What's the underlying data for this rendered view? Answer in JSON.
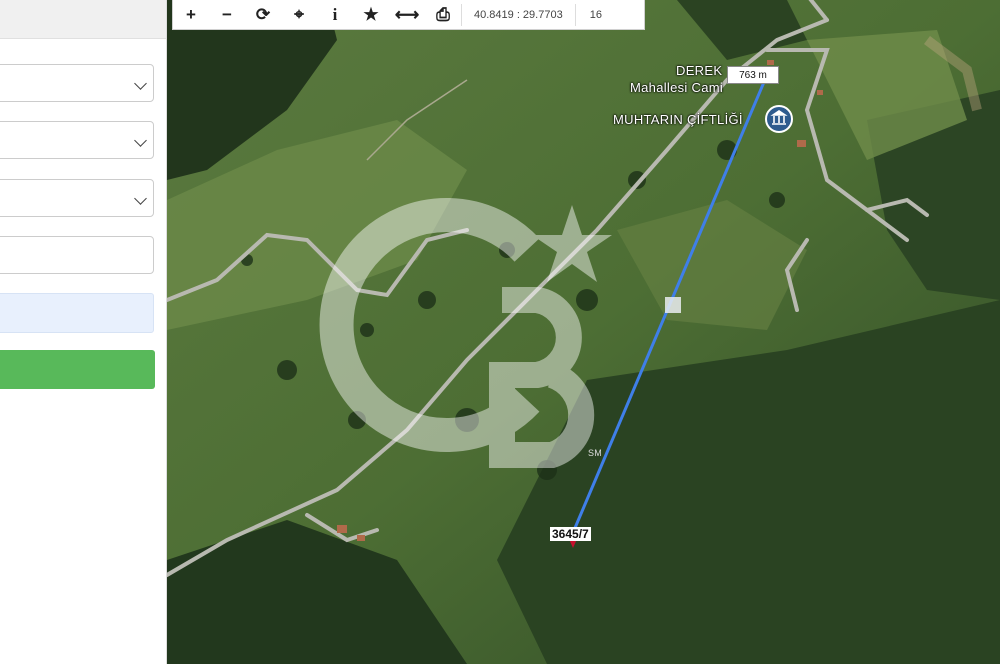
{
  "toolbar": {
    "zoom_in": "+",
    "zoom_out": "−",
    "refresh": "⟳",
    "locate": "⌖",
    "info": "i",
    "favorite": "★",
    "measure": "⟷",
    "print": "⎙",
    "coordinates": "40.8419 : 29.7703",
    "zoom_level": "16"
  },
  "map": {
    "labels": {
      "mosque_line1": "DEREK",
      "mosque_line2": "Mahallesi Cami",
      "farm": "MUHTARIN ÇİFTLİĞİ"
    },
    "distance": "763 m",
    "parcel": "3645/7",
    "watermark_sm": "SM",
    "colors": {
      "measure_line": "#3f7fe8",
      "marker": "#c8102e"
    },
    "icons": {
      "museum": "museum-icon",
      "pin": "parcel-marker-icon"
    }
  }
}
